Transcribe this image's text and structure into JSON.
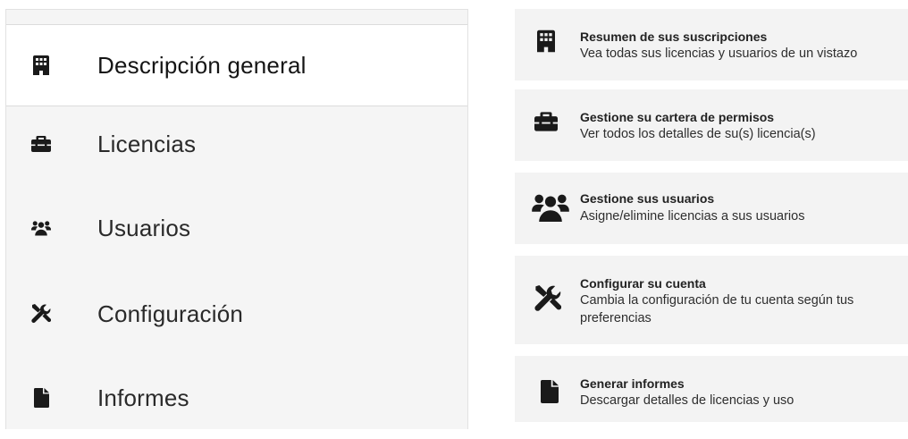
{
  "sidebar": {
    "items": [
      {
        "label": "Descripción general",
        "icon": "building-icon",
        "active": true
      },
      {
        "label": "Licencias",
        "icon": "briefcase-icon",
        "active": false
      },
      {
        "label": "Usuarios",
        "icon": "users-icon",
        "active": false
      },
      {
        "label": "Configuración",
        "icon": "tools-icon",
        "active": false
      },
      {
        "label": "Informes",
        "icon": "document-icon",
        "active": false
      }
    ]
  },
  "cards": [
    {
      "title": "Resumen de sus suscripciones",
      "description": "Vea todas sus licencias y usuarios de un vistazo",
      "icon": "building-icon"
    },
    {
      "title": "Gestione su cartera de permisos",
      "description": "Ver todos los detalles de su(s) licencia(s)",
      "icon": "briefcase-icon"
    },
    {
      "title": "Gestione sus usuarios",
      "description": "Asigne/elimine licencias a sus usuarios",
      "icon": "users-icon"
    },
    {
      "title": "Configurar su cuenta",
      "description": "Cambia la configuración de tu cuenta según tus preferencias",
      "icon": "tools-icon"
    },
    {
      "title": "Generar informes",
      "description": "Descargar detalles de licencias y uso",
      "icon": "document-icon"
    }
  ],
  "colors": {
    "icon": "#1a1a1a",
    "sidebar_bg": "#f5f5f5",
    "card_bg": "#f3f3f3",
    "active_bg": "#ffffff"
  }
}
